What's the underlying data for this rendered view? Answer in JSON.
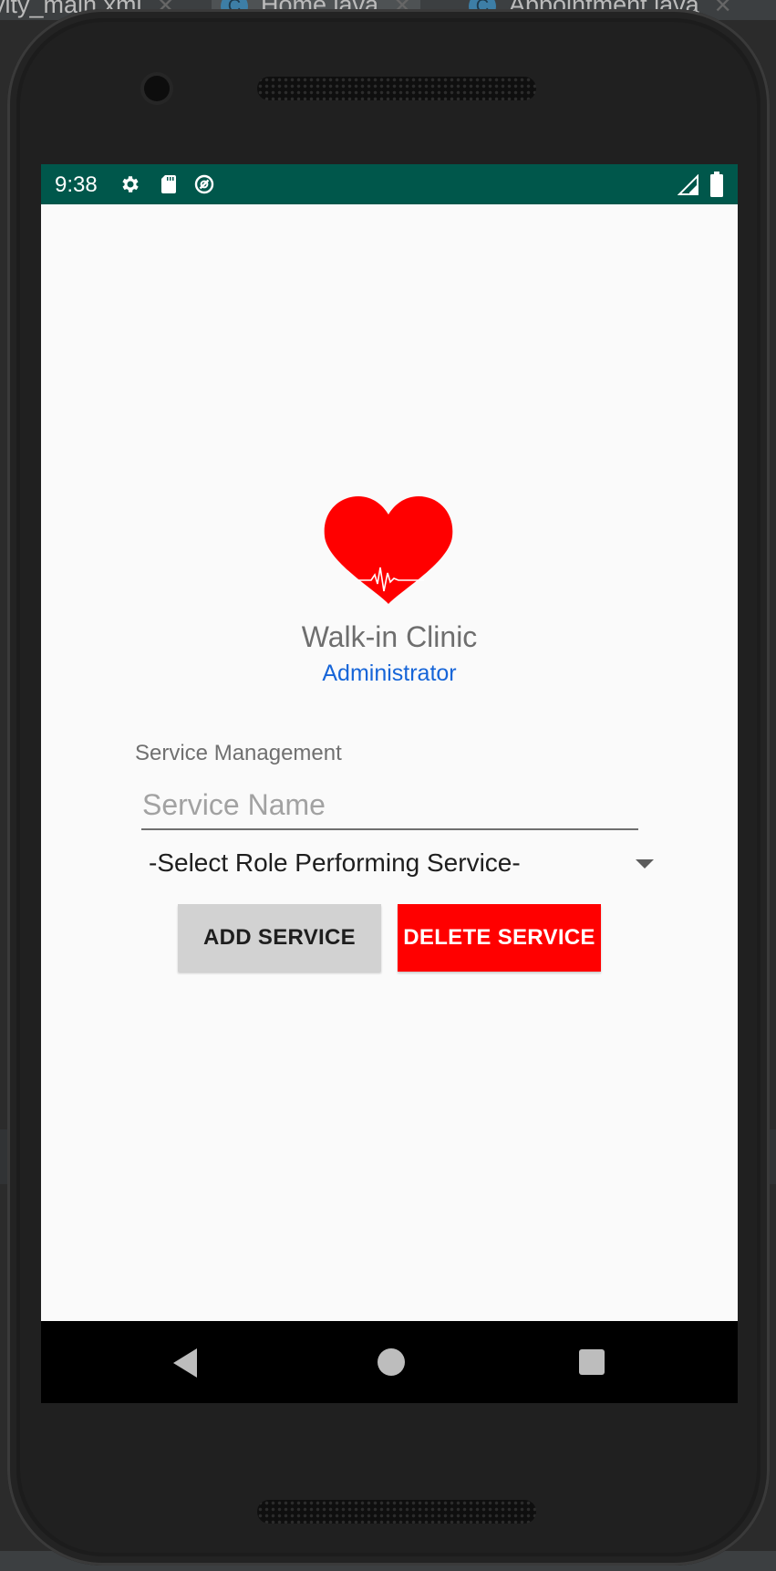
{
  "ide": {
    "tabs": [
      {
        "label": "vity_main.xml"
      },
      {
        "label": "Home.java",
        "badge": "C"
      },
      {
        "label": "Appointment.java",
        "badge": "C"
      }
    ]
  },
  "status_bar": {
    "time": "9:38",
    "icons": [
      "gear-icon",
      "sd-card-icon",
      "sync-icon",
      "signal-icon",
      "battery-icon"
    ],
    "color": "#00574b"
  },
  "app": {
    "logo": "heart-pulse-logo",
    "title": "Walk-in Clinic",
    "subtitle": "Administrator",
    "subtitle_color": "#1665d8"
  },
  "service_management": {
    "section_label": "Service Management",
    "service_name_placeholder": "Service Name",
    "service_name_value": "",
    "role_selected": "-Select Role Performing Service-",
    "add_button": "ADD SERVICE",
    "delete_button": "DELETE SERVICE",
    "delete_color": "#ff0000"
  },
  "nav_bar": {
    "icons": [
      "back-icon",
      "home-icon",
      "recents-icon"
    ]
  }
}
